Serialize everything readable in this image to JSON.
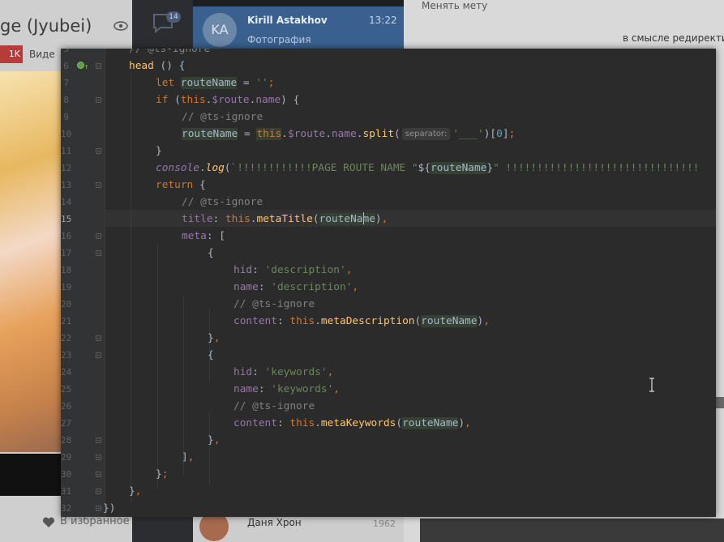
{
  "background": {
    "left_title": "ge (Jyubei)",
    "left_badge": "1K",
    "left_vide": "Виде",
    "favorites_label": "В избранное",
    "chat_badge": "14",
    "message": {
      "avatar_initials": "KA",
      "name": "Kirill Astakhov",
      "time": "13:22",
      "preview": "Фотография"
    },
    "right_top": "Менять мету",
    "right_line": "в смысле редиректи",
    "bottom_contact": {
      "name": "Даня Хрон",
      "number": "1962"
    }
  },
  "editor": {
    "lines": [
      {
        "n": "5",
        "tokens": [
          [
            "cmt",
            "// @ts-ignore"
          ]
        ],
        "indent": 84
      },
      {
        "n": "6",
        "tokens": [
          [
            "fn",
            "head"
          ],
          [
            "plain",
            " () {"
          ]
        ],
        "indent": 84,
        "marker": true
      },
      {
        "n": "7",
        "tokens": [
          [
            "kw",
            "let "
          ],
          [
            "plain-hl",
            "routeName"
          ],
          [
            "plain",
            " = "
          ],
          [
            "str",
            "''"
          ],
          [
            "kw",
            ";"
          ]
        ],
        "indent": 117
      },
      {
        "n": "8",
        "tokens": [
          [
            "kw",
            "if "
          ],
          [
            "plain",
            "("
          ],
          [
            "kw",
            "this"
          ],
          [
            "plain",
            "."
          ],
          [
            "prop",
            "$route"
          ],
          [
            "plain",
            "."
          ],
          [
            "prop",
            "name"
          ],
          [
            "plain",
            ") {"
          ]
        ],
        "indent": 117
      },
      {
        "n": "9",
        "tokens": [
          [
            "cmt",
            "// @ts-ignore"
          ]
        ],
        "indent": 149
      },
      {
        "n": "10",
        "tokens": [
          [
            "plain-hl",
            "routeName"
          ],
          [
            "plain",
            " = "
          ],
          [
            "kw-hl2",
            "this"
          ],
          [
            "plain",
            "."
          ],
          [
            "prop",
            "$route"
          ],
          [
            "plain",
            "."
          ],
          [
            "prop",
            "name"
          ],
          [
            "plain",
            "."
          ],
          [
            "fn",
            "split"
          ],
          [
            "plain",
            "("
          ],
          [
            "hint",
            "separator:"
          ],
          [
            "str",
            "'___'"
          ],
          [
            "plain",
            ")["
          ],
          [
            "num",
            "0"
          ],
          [
            "plain",
            "]"
          ],
          [
            "kw",
            ";"
          ]
        ],
        "indent": 149
      },
      {
        "n": "11",
        "tokens": [
          [
            "plain",
            "}"
          ]
        ],
        "indent": 117
      },
      {
        "n": "12",
        "tokens": [
          [
            "glob",
            "console"
          ],
          [
            "plain",
            "."
          ],
          [
            "fn-i",
            "log"
          ],
          [
            "plain",
            "("
          ],
          [
            "str",
            "`!!!!!!!!!!!!PAGE ROUTE NAME \""
          ],
          [
            "plain",
            "${"
          ],
          [
            "plain-hl",
            "routeName"
          ],
          [
            "plain",
            "}"
          ],
          [
            "str",
            "\" !!!!!!!!!!!!!!!!!!!!!!!!!!!!!!!"
          ]
        ],
        "indent": 117
      },
      {
        "n": "13",
        "tokens": [
          [
            "kw",
            "return "
          ],
          [
            "plain",
            "{"
          ]
        ],
        "indent": 117
      },
      {
        "n": "14",
        "tokens": [
          [
            "cmt",
            "// @ts-ignore"
          ]
        ],
        "indent": 149
      },
      {
        "n": "15",
        "tokens": [
          [
            "prop",
            "title"
          ],
          [
            "plain",
            ": "
          ],
          [
            "kw",
            "this"
          ],
          [
            "plain",
            "."
          ],
          [
            "fn",
            "metaTitle"
          ],
          [
            "plain",
            "("
          ],
          [
            "plain-hl-caret",
            "routeNa|me"
          ],
          [
            "plain",
            ")"
          ],
          [
            "kw",
            ","
          ]
        ],
        "indent": 149,
        "current": true
      },
      {
        "n": "16",
        "tokens": [
          [
            "prop",
            "meta"
          ],
          [
            "plain",
            ": ["
          ]
        ],
        "indent": 149
      },
      {
        "n": "17",
        "tokens": [
          [
            "plain",
            "{"
          ]
        ],
        "indent": 181
      },
      {
        "n": "18",
        "tokens": [
          [
            "prop",
            "hid"
          ],
          [
            "plain",
            ": "
          ],
          [
            "str",
            "'description'"
          ],
          [
            "kw",
            ","
          ]
        ],
        "indent": 213
      },
      {
        "n": "19",
        "tokens": [
          [
            "prop",
            "name"
          ],
          [
            "plain",
            ": "
          ],
          [
            "str",
            "'description'"
          ],
          [
            "kw",
            ","
          ]
        ],
        "indent": 213
      },
      {
        "n": "20",
        "tokens": [
          [
            "cmt",
            "// @ts-ignore"
          ]
        ],
        "indent": 213
      },
      {
        "n": "21",
        "tokens": [
          [
            "prop",
            "content"
          ],
          [
            "plain",
            ": "
          ],
          [
            "kw",
            "this"
          ],
          [
            "plain",
            "."
          ],
          [
            "fn",
            "metaDescription"
          ],
          [
            "plain",
            "("
          ],
          [
            "plain-hl",
            "routeName"
          ],
          [
            "plain",
            ")"
          ],
          [
            "kw",
            ","
          ]
        ],
        "indent": 213
      },
      {
        "n": "22",
        "tokens": [
          [
            "plain",
            "}"
          ],
          [
            "kw",
            ","
          ]
        ],
        "indent": 181
      },
      {
        "n": "23",
        "tokens": [
          [
            "plain",
            "{"
          ]
        ],
        "indent": 181
      },
      {
        "n": "24",
        "tokens": [
          [
            "prop",
            "hid"
          ],
          [
            "plain",
            ": "
          ],
          [
            "str",
            "'keywords'"
          ],
          [
            "kw",
            ","
          ]
        ],
        "indent": 213
      },
      {
        "n": "25",
        "tokens": [
          [
            "prop",
            "name"
          ],
          [
            "plain",
            ": "
          ],
          [
            "str",
            "'keywords'"
          ],
          [
            "kw",
            ","
          ]
        ],
        "indent": 213
      },
      {
        "n": "26",
        "tokens": [
          [
            "cmt",
            "// @ts-ignore"
          ]
        ],
        "indent": 213
      },
      {
        "n": "27",
        "tokens": [
          [
            "prop",
            "content"
          ],
          [
            "plain",
            ": "
          ],
          [
            "kw",
            "this"
          ],
          [
            "plain",
            "."
          ],
          [
            "fn",
            "metaKeywords"
          ],
          [
            "plain",
            "("
          ],
          [
            "plain-hl",
            "routeName"
          ],
          [
            "plain",
            ")"
          ],
          [
            "kw",
            ","
          ]
        ],
        "indent": 213
      },
      {
        "n": "28",
        "tokens": [
          [
            "plain",
            "}"
          ],
          [
            "kw",
            ","
          ]
        ],
        "indent": 181
      },
      {
        "n": "29",
        "tokens": [
          [
            "plain",
            "]"
          ],
          [
            "kw",
            ","
          ]
        ],
        "indent": 149
      },
      {
        "n": "30",
        "tokens": [
          [
            "plain",
            "}"
          ],
          [
            "kw",
            ";"
          ]
        ],
        "indent": 117
      },
      {
        "n": "31",
        "tokens": [
          [
            "plain",
            "}"
          ],
          [
            "kw",
            ","
          ]
        ],
        "indent": 84
      },
      {
        "n": "32",
        "tokens": [
          [
            "plain",
            "})"
          ]
        ],
        "indent": 52
      }
    ]
  }
}
